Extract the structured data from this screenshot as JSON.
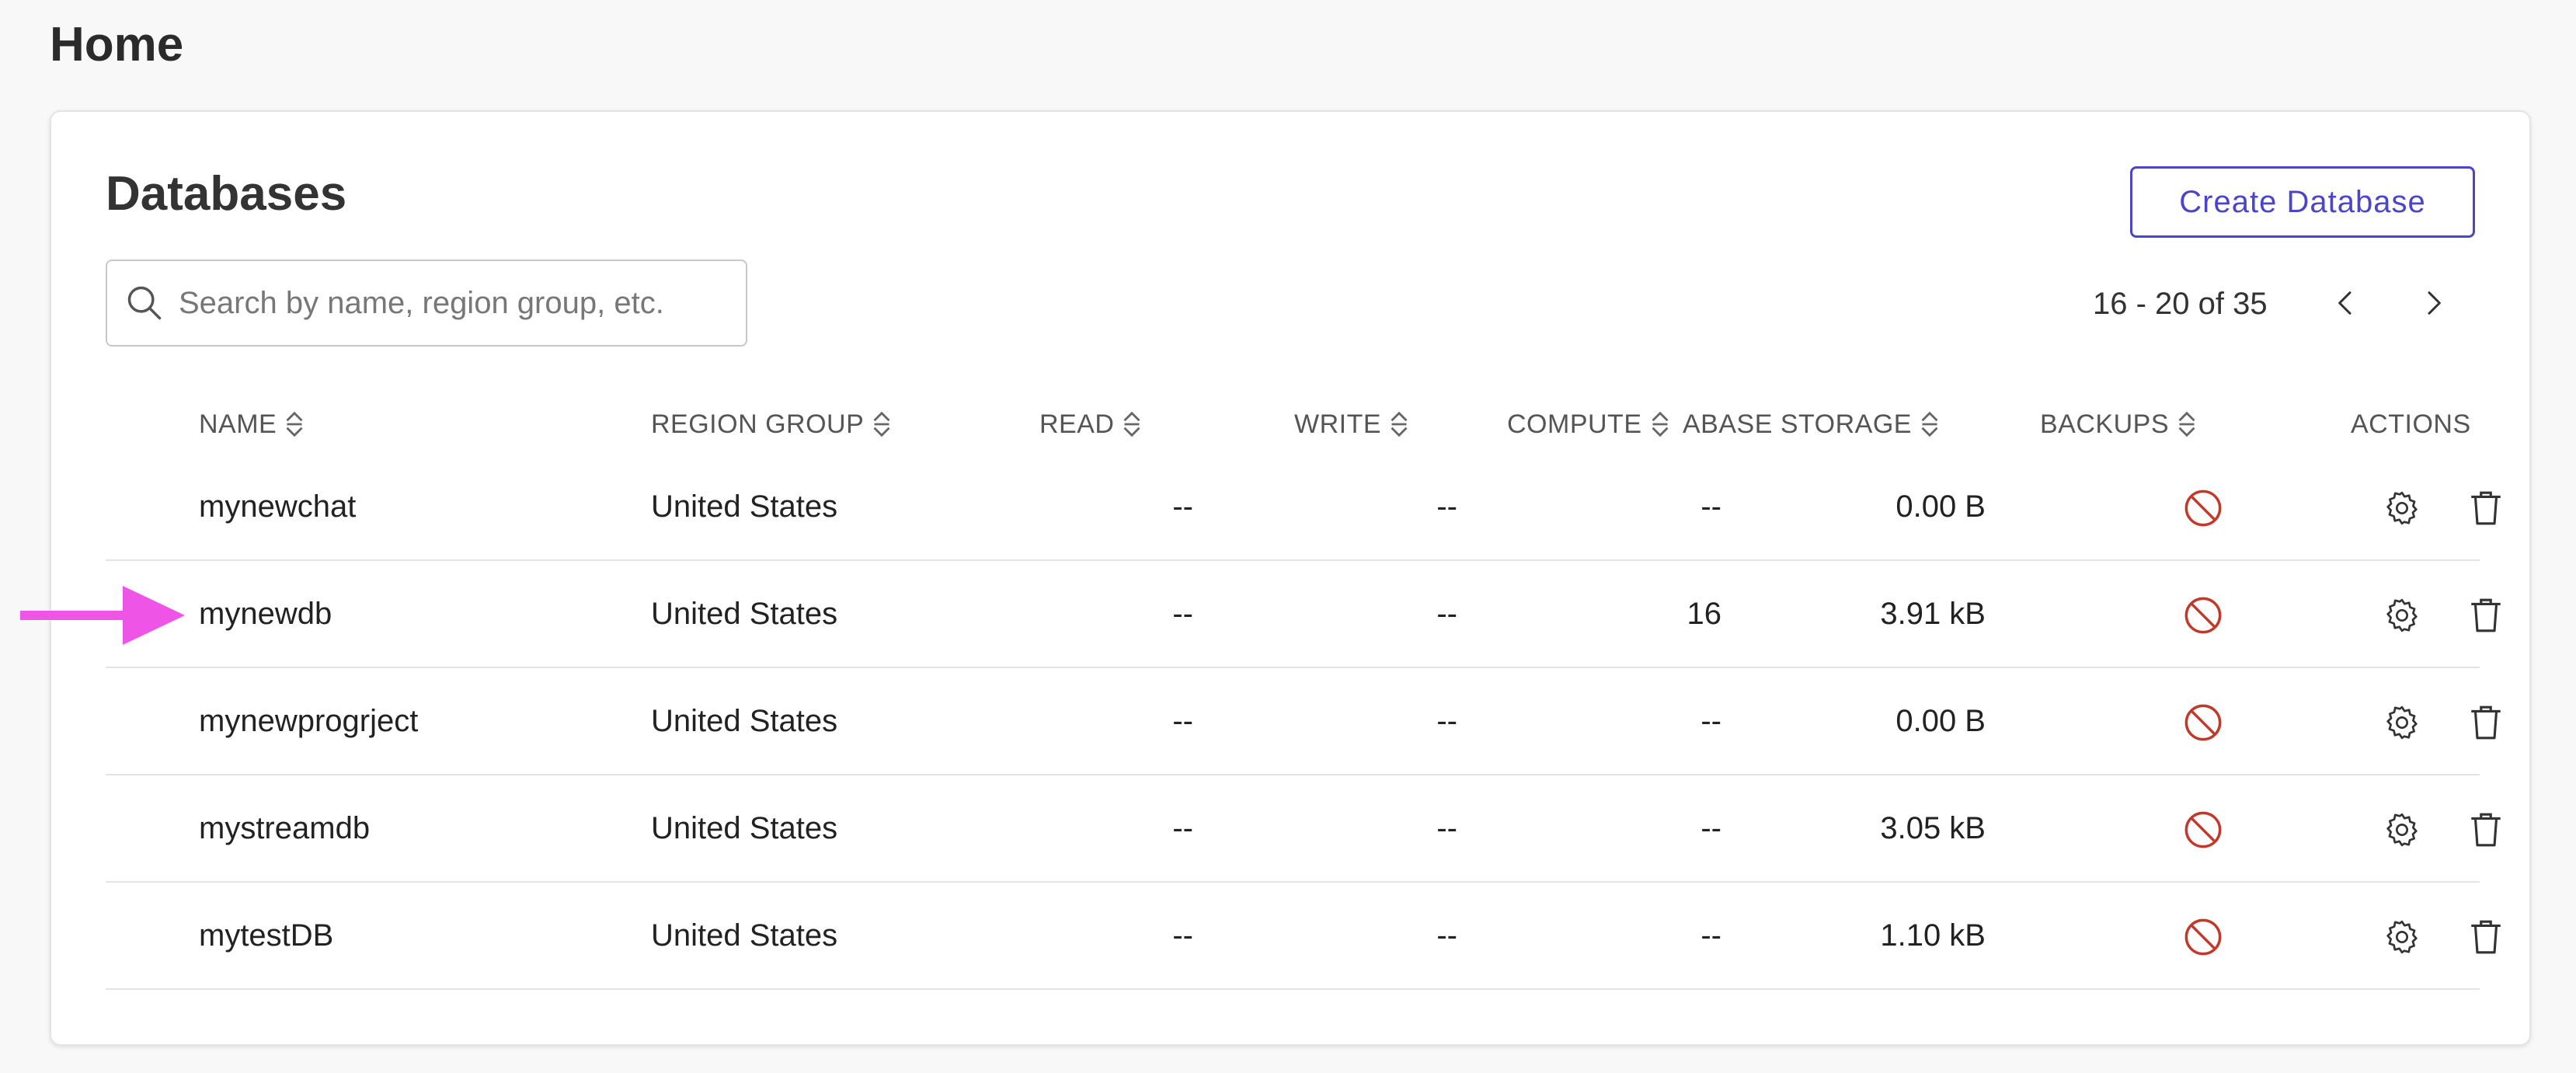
{
  "page": {
    "title": "Home"
  },
  "card": {
    "title": "Databases",
    "create_button": "Create Database",
    "search": {
      "placeholder": "Search by name, region group, etc.",
      "value": ""
    },
    "pagination": {
      "range_text": "16 - 20 of 35"
    }
  },
  "table": {
    "columns": {
      "name": "NAME",
      "region": "REGION GROUP",
      "read": "READ",
      "write": "WRITE",
      "compute": "COMPUTE",
      "storage": "ABASE STORAGE",
      "backups": "BACKUPS",
      "actions": "ACTIONS"
    },
    "rows": [
      {
        "name": "mynewchat",
        "region": "United States",
        "read": "--",
        "write": "--",
        "compute": "--",
        "storage": "0.00 B"
      },
      {
        "name": "mynewdb",
        "region": "United States",
        "read": "--",
        "write": "--",
        "compute": "16",
        "storage": "3.91 kB"
      },
      {
        "name": "mynewprogrject",
        "region": "United States",
        "read": "--",
        "write": "--",
        "compute": "--",
        "storage": "0.00 B"
      },
      {
        "name": "mystreamdb",
        "region": "United States",
        "read": "--",
        "write": "--",
        "compute": "--",
        "storage": "3.05 kB"
      },
      {
        "name": "mytestDB",
        "region": "United States",
        "read": "--",
        "write": "--",
        "compute": "--",
        "storage": "1.10 kB"
      }
    ]
  },
  "icons": {
    "search": "search-icon",
    "prev": "chevron-left-icon",
    "next": "chevron-right-icon",
    "sort": "sort-icon",
    "backup_disabled": "prohibited-icon",
    "settings": "gear-icon",
    "delete": "trash-icon",
    "annotation": "arrow-right-icon"
  },
  "colors": {
    "accent": "#4b45c9",
    "prohibited": "#c0392b",
    "annotation_arrow": "#ee55e6"
  }
}
